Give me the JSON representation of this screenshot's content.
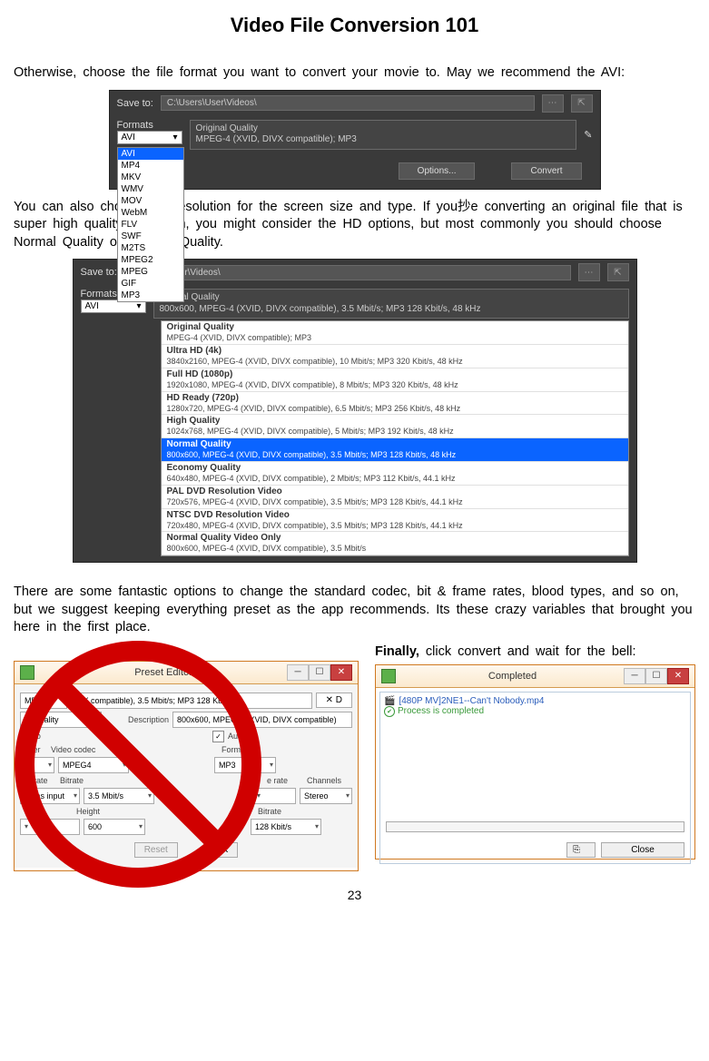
{
  "title": "Video File Conversion 101",
  "para1": "Otherwise,  choose  the  file  format  you  want  to  convert  your  movie  to.  May  we recommend  the  AVI:",
  "para2": "You  can also choose  the  resolution   for  the  screen  size and  type.   If you抄e converting   an original  file that is super  high  quality  resolution,   you  might  consider  the  HD options,   but  most  commonly   you  should choose  Normal   Quality   or Original   Quality.",
  "para3": "There  are  some  fantastic   options   to  change  the  standard   codec,  bit  &  frame   rates,  blood   types,  and  so on,  but  we  suggest  keeping   everything    preset   as the  app  recommends.    Its   these  crazy  variables   that brought   you  here  in the  first  place.",
  "finally_prefix": "Finally, ",
  "finally_rest": "click convert   and  wait  for  the  bell:",
  "page": "23",
  "shot1": {
    "save_label": "Save to:",
    "save_path": "C:\\Users\\User\\Videos\\",
    "formats_label": "Formats",
    "selected": "AVI",
    "options": [
      "AVI",
      "MP4",
      "MKV",
      "WMV",
      "MOV",
      "WebM",
      "FLV",
      "SWF",
      "M2TS",
      "MPEG2",
      "MPEG",
      "GIF",
      "MP3"
    ],
    "quality_line1": "Original Quality",
    "quality_line2": "MPEG-4 (XVID, DIVX compatible); MP3",
    "btn_options": "Options...",
    "btn_convert": "Convert"
  },
  "shot2": {
    "save_label": "Save to:",
    "save_path": "C:\\Users\\User\\Videos\\",
    "formats_label": "Formats",
    "selected": "AVI",
    "current_t": "Normal Quality",
    "current_s": "800x600, MPEG-4 (XVID, DIVX compatible), 3.5 Mbit/s; MP3 128 Kbit/s, 48 kHz",
    "list": [
      {
        "t": "Original Quality",
        "s": "MPEG-4 (XVID, DIVX compatible); MP3"
      },
      {
        "t": "Ultra HD (4k)",
        "s": "3840x2160, MPEG-4 (XVID, DIVX compatible), 10 Mbit/s; MP3 320 Kbit/s, 48 kHz"
      },
      {
        "t": "Full HD (1080p)",
        "s": "1920x1080, MPEG-4 (XVID, DIVX compatible), 8 Mbit/s; MP3 320 Kbit/s, 48 kHz"
      },
      {
        "t": "HD Ready (720p)",
        "s": "1280x720, MPEG-4 (XVID, DIVX compatible), 6.5 Mbit/s; MP3 256 Kbit/s, 48 kHz"
      },
      {
        "t": "High Quality",
        "s": "1024x768, MPEG-4 (XVID, DIVX compatible), 5 Mbit/s; MP3 192 Kbit/s, 48 kHz"
      },
      {
        "t": "Normal Quality",
        "s": "800x600, MPEG-4 (XVID, DIVX compatible), 3.5 Mbit/s; MP3 128 Kbit/s, 48 kHz",
        "hl": true
      },
      {
        "t": "Economy Quality",
        "s": "640x480, MPEG-4 (XVID, DIVX compatible), 2 Mbit/s; MP3 112 Kbit/s, 44.1 kHz"
      },
      {
        "t": "PAL DVD Resolution Video",
        "s": "720x576, MPEG-4 (XVID, DIVX compatible), 3.5 Mbit/s; MP3 128 Kbit/s, 44.1 kHz"
      },
      {
        "t": "NTSC DVD Resolution Video",
        "s": "720x480, MPEG-4 (XVID, DIVX compatible), 3.5 Mbit/s; MP3 128 Kbit/s, 44.1 kHz"
      },
      {
        "t": "Normal Quality Video Only",
        "s": "800x600, MPEG-4 (XVID, DIVX compatible), 3.5 Mbit/s"
      }
    ]
  },
  "preset": {
    "title": "Preset Editor",
    "name_row1_right": "IVX compatible), 3.5 Mbit/s; MP3 128 Kbit/s,",
    "name_left": "al Quality",
    "desc_lbl": "Description",
    "desc_val": "800x600, MPEG-4 (XVID, DIVX compatible)",
    "video_lbl": "Video",
    "audio_lbl": "Audio",
    "container_lbl": "tainer",
    "codec_lbl": "Video codec",
    "codec_val": "MPEG4",
    "format_lbl": "Format",
    "format_val": "MP3",
    "frate_lbl": "me rate",
    "frate_val": "ne as input",
    "bitrate_lbl": "Bitrate",
    "bitrate_val": "3.5 Mbit/s",
    "arate_lbl": "e rate",
    "ch_lbl": "Channels",
    "ch_val": "Stereo",
    "height_lbl": "Height",
    "height_val": "600",
    "abr_lbl": "Bitrate",
    "abr_val": "128 Kbit/s",
    "delete_btn": "D",
    "reset": "Reset",
    "ok": "OK"
  },
  "completed": {
    "title": "Completed",
    "file": "[480P MV]2NE1--Can't Nobody.mp4",
    "status": "Process is completed",
    "close": "Close"
  }
}
